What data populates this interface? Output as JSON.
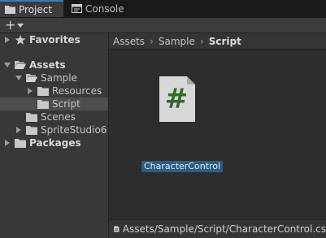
{
  "tabs": [
    {
      "label": "Project",
      "icon": "folder-icon",
      "active": true
    },
    {
      "label": "Console",
      "icon": "console-icon",
      "active": false
    }
  ],
  "toolbar": {
    "add_label": "+"
  },
  "tree": {
    "favorites": "Favorites",
    "assets": "Assets",
    "sample": "Sample",
    "resources": "Resources",
    "script": "Script",
    "scenes": "Scenes",
    "spritestudio": "SpriteStudio6",
    "packages": "Packages"
  },
  "breadcrumb": {
    "items": [
      "Assets",
      "Sample",
      "Script"
    ]
  },
  "asset": {
    "label": "CharacterControl",
    "glyph": "#"
  },
  "status": {
    "path": "Assets/Sample/Script/CharacterControl.cs",
    "glyph": "#"
  },
  "colors": {
    "accent": "#3a79bb",
    "selection": "#2c5d87",
    "script_green": "#2e6b2e"
  }
}
